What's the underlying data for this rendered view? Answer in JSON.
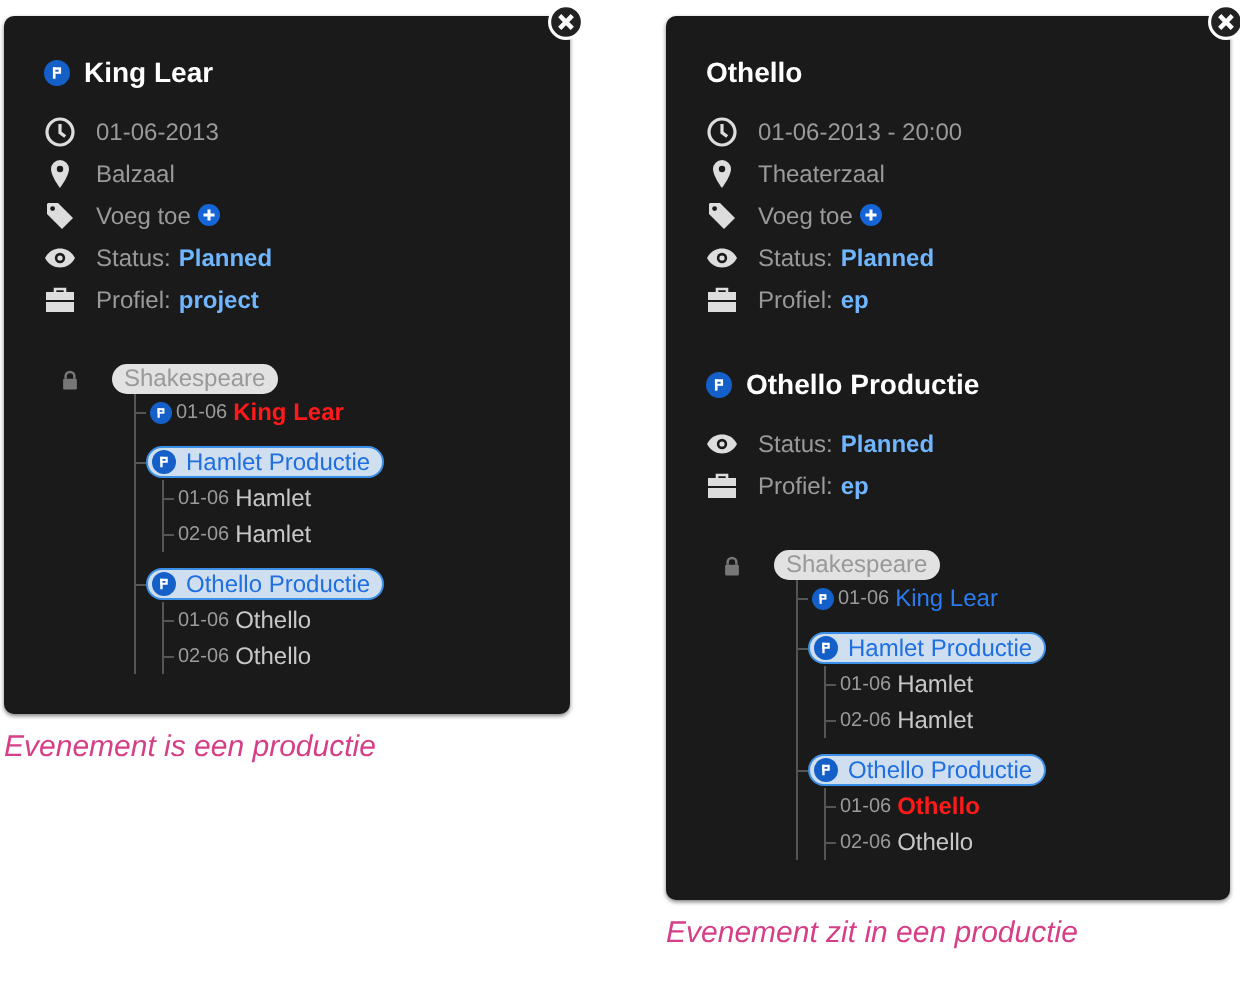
{
  "panels": [
    {
      "blocks": [
        {
          "title": "King Lear",
          "production": true,
          "rows": [
            {
              "kind": "date",
              "text": "01-06-2013"
            },
            {
              "kind": "location",
              "text": "Balzaal"
            },
            {
              "kind": "tags",
              "text": "Voeg toe"
            },
            {
              "kind": "status",
              "label": "Status:",
              "value": "Planned"
            },
            {
              "kind": "profile",
              "label": "Profiel:",
              "value": "project"
            }
          ]
        }
      ],
      "tree": {
        "label": "Shakespeare",
        "locked": true,
        "children": [
          {
            "kind": "event",
            "date": "01-06",
            "title": "King Lear",
            "production": true,
            "current": true
          },
          {
            "kind": "group",
            "title": "Hamlet Productie",
            "children": [
              {
                "kind": "event",
                "date": "01-06",
                "title": "Hamlet",
                "production": false,
                "current": false
              },
              {
                "kind": "event",
                "date": "02-06",
                "title": "Hamlet",
                "production": false,
                "current": false
              }
            ]
          },
          {
            "kind": "group",
            "title": "Othello Productie",
            "children": [
              {
                "kind": "event",
                "date": "01-06",
                "title": "Othello",
                "production": false,
                "current": false
              },
              {
                "kind": "event",
                "date": "02-06",
                "title": "Othello",
                "production": false,
                "current": false
              }
            ]
          }
        ]
      },
      "caption": "Evenement is een productie"
    },
    {
      "blocks": [
        {
          "title": "Othello",
          "production": false,
          "rows": [
            {
              "kind": "date",
              "text": "01-06-2013 - 20:00"
            },
            {
              "kind": "location",
              "text": "Theaterzaal"
            },
            {
              "kind": "tags",
              "text": "Voeg toe"
            },
            {
              "kind": "status",
              "label": "Status:",
              "value": "Planned"
            },
            {
              "kind": "profile",
              "label": "Profiel:",
              "value": "ep"
            }
          ]
        },
        {
          "title": "Othello Productie",
          "production": true,
          "rows": [
            {
              "kind": "status",
              "label": "Status:",
              "value": "Planned"
            },
            {
              "kind": "profile",
              "label": "Profiel:",
              "value": "ep"
            }
          ]
        }
      ],
      "tree": {
        "label": "Shakespeare",
        "locked": true,
        "children": [
          {
            "kind": "event",
            "date": "01-06",
            "title": "King Lear",
            "production": true,
            "current": false
          },
          {
            "kind": "group",
            "title": "Hamlet Productie",
            "children": [
              {
                "kind": "event",
                "date": "01-06",
                "title": "Hamlet",
                "production": false,
                "current": false
              },
              {
                "kind": "event",
                "date": "02-06",
                "title": "Hamlet",
                "production": false,
                "current": false
              }
            ]
          },
          {
            "kind": "group",
            "title": "Othello Productie",
            "children": [
              {
                "kind": "event",
                "date": "01-06",
                "title": "Othello",
                "production": false,
                "current": true
              },
              {
                "kind": "event",
                "date": "02-06",
                "title": "Othello",
                "production": false,
                "current": false
              }
            ]
          }
        ]
      },
      "caption": "Evenement zit in een productie"
    }
  ]
}
